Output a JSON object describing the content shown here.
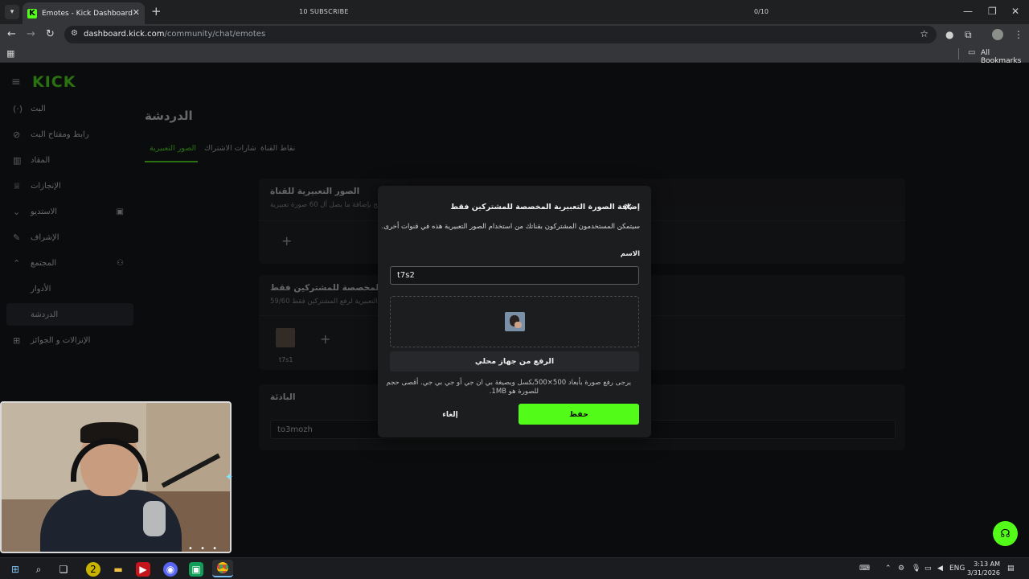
{
  "browser": {
    "tab_title": "Emotes - Kick Dashboard",
    "overlay_subscribe": "10 SUBSCRIBE",
    "overlay_counter": "0/10",
    "url_host": "dashboard.kick.com",
    "url_path": "/community/chat/emotes",
    "bookmarks_label": "All Bookmarks"
  },
  "sidebar": {
    "logo": "KICK",
    "items": [
      {
        "label": "البث"
      },
      {
        "label": "رابط ومفتاح البث"
      },
      {
        "label": "المقاد"
      },
      {
        "label": "الإنجازات"
      },
      {
        "label": "الاستديو"
      },
      {
        "label": "الإشراف"
      },
      {
        "label": "المجتمع"
      },
      {
        "label": "الأدوار"
      },
      {
        "label": "الدردشة"
      },
      {
        "label": "الإنزالات و الجوائز"
      }
    ]
  },
  "main": {
    "title": "الدردشة",
    "tabs": [
      {
        "label": "الصور التعبيرية"
      },
      {
        "label": "شارات الاشتراك"
      },
      {
        "label": "نقاط القناة"
      }
    ],
    "channel_emotes": {
      "title": "الصور التعبيرية للقناة",
      "subtitle": "اسمح بإضافة ما يصل أل 60 صورة تعبيرية"
    },
    "sub_emotes": {
      "title": "الصور التعبيرية المخصصة للمشتركين فقط",
      "subtitle": "59/60 الصور التعبيرية لرفع المشتركين فقط",
      "emote_name": "t7s1"
    },
    "prefix": {
      "title": "البادئة",
      "value": "to3mozh"
    }
  },
  "modal": {
    "title": "إضافة الصورة التعبيرية المخصصة للمشتركين فقط",
    "description": "سيتمكن المستخدمون المشتركون بقناتك من استخدام الصور التعبيرية هذه في قنوات أخرى.",
    "name_label": "الاسم",
    "name_value": "t7s2",
    "upload_label": "الرفع من جهاز محلي",
    "hint_line1": "يرجى رفع صورة بأبعاد 500×500بكسل وبصيغة بي ان جي أو جي بي جي. أقصى حجم",
    "hint_line2": "للصورة هو 1MB.",
    "cancel_label": "إلغاء",
    "save_label": "حفظ"
  },
  "taskbar": {
    "language": "ENG",
    "time": "3:13 AM",
    "date": "3/31/2026"
  },
  "colors": {
    "accent": "#53fc18",
    "background": "#0b0c0d",
    "modal": "#1c1d1f"
  }
}
